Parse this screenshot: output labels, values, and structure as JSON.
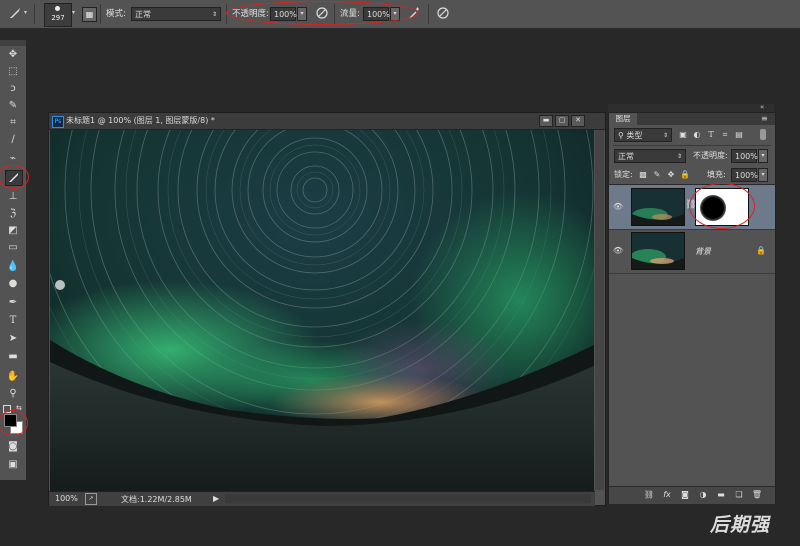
{
  "options": {
    "brush_size": "297",
    "mode_label": "模式:",
    "mode_value": "正常",
    "opacity_label": "不透明度:",
    "opacity_value": "100%",
    "flow_label": "流量:",
    "flow_value": "100%"
  },
  "document": {
    "title": "未标题1 @ 100% (图层 1, 图层蒙版/8) *",
    "zoom": "100%",
    "doc_info": "文档:1.22M/2.85M"
  },
  "layers_panel": {
    "tab": "图层",
    "filter_label": "类型",
    "blend_mode": "正常",
    "opacity_label": "不透明度:",
    "opacity_value": "100%",
    "lock_label": "锁定:",
    "fill_label": "填充:",
    "fill_value": "100%",
    "layers": [
      {
        "name": "",
        "has_mask": true,
        "selected": true
      },
      {
        "name": "背景",
        "has_mask": false,
        "selected": false,
        "locked": true
      }
    ]
  },
  "watermark": "后期强",
  "colors": {
    "accent_highlight": "#d22222",
    "selected_layer": "#6d7a8c",
    "panel_bg": "#535353",
    "app_bg": "#282828"
  }
}
